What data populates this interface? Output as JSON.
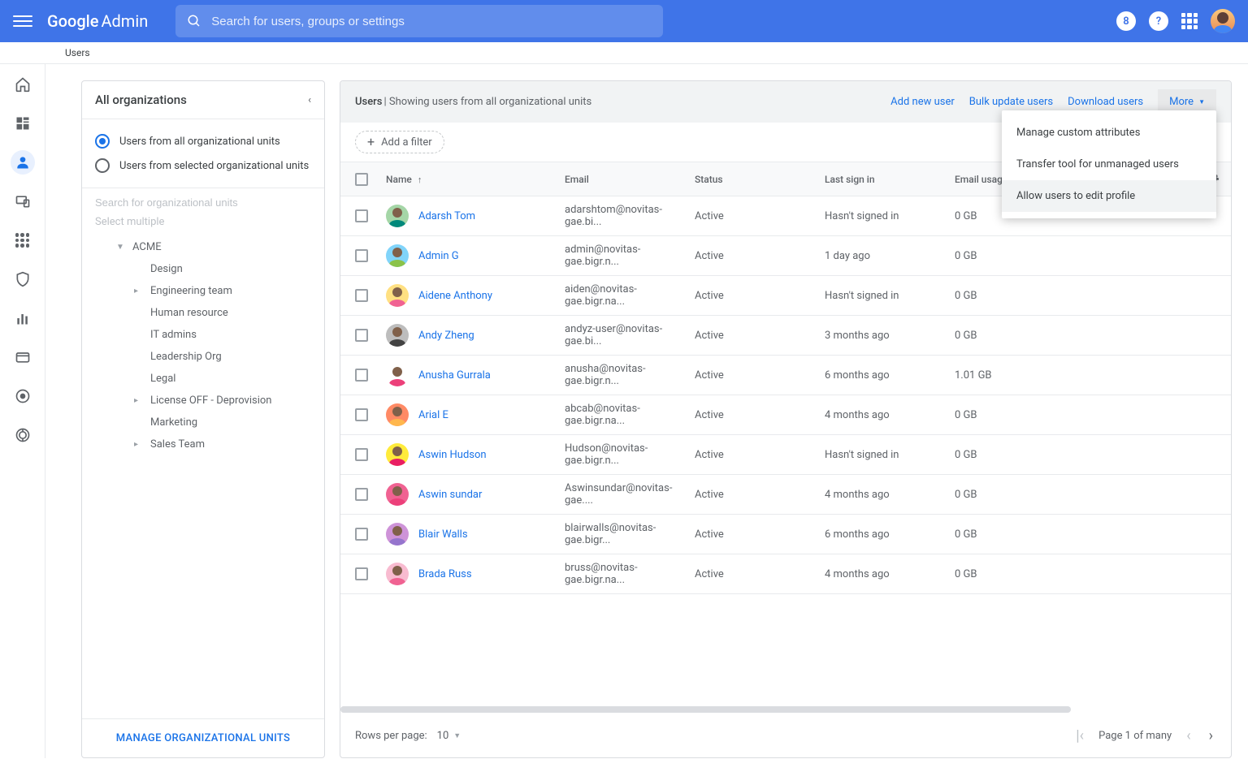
{
  "header": {
    "logo_prefix": "Google",
    "logo_suffix": "Admin",
    "search_placeholder": "Search for users, groups or settings",
    "badge": "8"
  },
  "breadcrumb": "Users",
  "sidebar": {
    "title": "All organizations",
    "radio_all": "Users from all organizational units",
    "radio_selected": "Users from selected organizational units",
    "search_placeholder": "Search for organizational units",
    "select_multiple": "Select multiple",
    "root": "ACME",
    "children": [
      {
        "label": "Design",
        "expandable": false
      },
      {
        "label": "Engineering team",
        "expandable": true
      },
      {
        "label": "Human resource",
        "expandable": false
      },
      {
        "label": "IT admins",
        "expandable": false
      },
      {
        "label": "Leadership Org",
        "expandable": false
      },
      {
        "label": "Legal",
        "expandable": false
      },
      {
        "label": "License OFF - Deprovision",
        "expandable": true
      },
      {
        "label": "Marketing",
        "expandable": false
      },
      {
        "label": "Sales Team",
        "expandable": true
      }
    ],
    "manage_label": "MANAGE ORGANIZATIONAL UNITS"
  },
  "main": {
    "title": "Users",
    "subtitle": " | Showing users from all organizational units",
    "actions": {
      "add": "Add new user",
      "bulk": "Bulk update users",
      "download": "Download users",
      "more": "More"
    },
    "dropdown": [
      "Manage custom attributes",
      "Transfer tool for unmanaged users",
      "Allow users to edit profile"
    ],
    "add_filter": "Add a filter",
    "columns": {
      "name": "Name",
      "email": "Email",
      "status": "Status",
      "signin": "Last sign in",
      "usage": "Email usage"
    },
    "rows": [
      {
        "name": "Adarsh Tom",
        "email": "adarshtom@novitas-gae.bi...",
        "status": "Active",
        "signin": "Hasn't signed in",
        "usage": "0 GB",
        "bg": "#a5d6a7",
        "shirt": "#00897b"
      },
      {
        "name": "Admin G",
        "email": "admin@novitas-gae.bigr.n...",
        "status": "Active",
        "signin": "1 day ago",
        "usage": "0 GB",
        "bg": "#81d4fa",
        "shirt": "#8bc34a"
      },
      {
        "name": "Aidene Anthony",
        "email": "aiden@novitas-gae.bigr.na...",
        "status": "Active",
        "signin": "Hasn't signed in",
        "usage": "0 GB",
        "bg": "#ffe082",
        "shirt": "#f06292"
      },
      {
        "name": "Andy Zheng",
        "email": "andyz-user@novitas-gae.bi...",
        "status": "Active",
        "signin": "3 months ago",
        "usage": "0 GB",
        "bg": "#bdbdbd",
        "shirt": "#424242"
      },
      {
        "name": "Anusha Gurrala",
        "email": "anusha@novitas-gae.bigr.n...",
        "status": "Active",
        "signin": "6 months ago",
        "usage": "1.01 GB",
        "bg": "#ffffff",
        "shirt": "#ec407a"
      },
      {
        "name": "Arial E",
        "email": "abcab@novitas-gae.bigr.na...",
        "status": "Active",
        "signin": "4 months ago",
        "usage": "0 GB",
        "bg": "#ff8a65",
        "shirt": "#ffb74d"
      },
      {
        "name": "Aswin Hudson",
        "email": "Hudson@novitas-gae.bigr.n...",
        "status": "Active",
        "signin": "Hasn't signed in",
        "usage": "0 GB",
        "bg": "#ffeb3b",
        "shirt": "#e91e63"
      },
      {
        "name": "Aswin sundar",
        "email": "Aswinsundar@novitas-gae....",
        "status": "Active",
        "signin": "4 months ago",
        "usage": "0 GB",
        "bg": "#f06292",
        "shirt": "#ec407a"
      },
      {
        "name": "Blair Walls",
        "email": "blairwalls@novitas-gae.bigr...",
        "status": "Active",
        "signin": "6 months ago",
        "usage": "0 GB",
        "bg": "#ce93d8",
        "shirt": "#9575cd"
      },
      {
        "name": "Brada Russ",
        "email": "bruss@novitas-gae.bigr.na...",
        "status": "Active",
        "signin": "4 months ago",
        "usage": "0 GB",
        "bg": "#f8bbd0",
        "shirt": "#f06292"
      }
    ],
    "footer": {
      "rpp_label": "Rows per page:",
      "rpp_value": "10",
      "page_label": "Page 1 of many"
    }
  }
}
